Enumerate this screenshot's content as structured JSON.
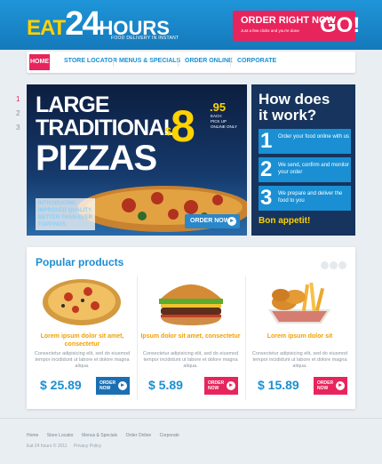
{
  "header": {
    "logo_eat": "EAT",
    "logo_num": "24",
    "logo_hours": "HOURS",
    "logo_sub": "FOOD DELIVERY IN INSTANT",
    "order_title": "ORDER RIGHT NOW",
    "order_sub": "Just a few clicks and you're done",
    "order_go": "GO!"
  },
  "nav": {
    "items": [
      "HOME",
      "STORE LOCATOR",
      "MENUS & SPECIALS",
      "ORDER ONLINE",
      "CORPORATE"
    ]
  },
  "pager": [
    "1",
    "2",
    "3"
  ],
  "hero": {
    "line1": "LARGE",
    "line2": "TRADITIONAL",
    "line3": "PIZZAS",
    "price_dollar": "$",
    "price_main": "8",
    "price_cents": ".95",
    "price_note": [
      "EACH",
      "PICK UP",
      "ONLINE ONLY"
    ],
    "tagline": [
      "INTRODUCING",
      "IMPROVED QUALITY.",
      "BETTER-THAN-EVER",
      "TOPPINGS."
    ],
    "button": "ORDER NOW"
  },
  "how": {
    "title_line1": "How does",
    "title_line2": "it work?",
    "steps": [
      {
        "num": "1",
        "text": "Order your food online with us"
      },
      {
        "num": "2",
        "text": "We send, confirm and monitor your order"
      },
      {
        "num": "3",
        "text": "We prepare and deliver the food to you"
      }
    ],
    "closing": "Bon appetit!"
  },
  "popular": {
    "title": "Popular products",
    "products": [
      {
        "title": "Lorem ipsum dolor sit amet, consectetur",
        "desc": "Consectetur adipisicing elit, sed do eiusmod tempor incididunt ut labore et dolore magna aliqua.",
        "price": "$ 25.89",
        "button": "ORDER NOW",
        "icon": "pizza-icon"
      },
      {
        "title": "Ipsum dolor sit amet, consectetur",
        "desc": "Consectetur adipisicing elit, sed do eiusmod tempor incididunt ut labore et dolore magna aliqua.",
        "price": "$ 5.89",
        "button": "ORDER NOW",
        "icon": "burger-icon"
      },
      {
        "title": "Lorem ipsum dolor sit",
        "desc": "Consectetur adipisicing elit, sed do eiusmod tempor incididunt ut labore et dolore magna aliqua.",
        "price": "$ 15.89",
        "button": "ORDER NOW",
        "icon": "shrimp-fries-icon"
      }
    ]
  },
  "footer": {
    "links": [
      "Home",
      "Store Locator",
      "Menus & Specials",
      "Order Online",
      "Corporate"
    ],
    "copyright": "Eat 24 hours © 2011",
    "privacy": "Privacy Policy"
  },
  "colors": {
    "header_blue": "#1479bb",
    "accent_pink": "#e8245d",
    "accent_yellow": "#ffd200",
    "navy": "#16345d",
    "link_blue": "#1a8fd3"
  }
}
